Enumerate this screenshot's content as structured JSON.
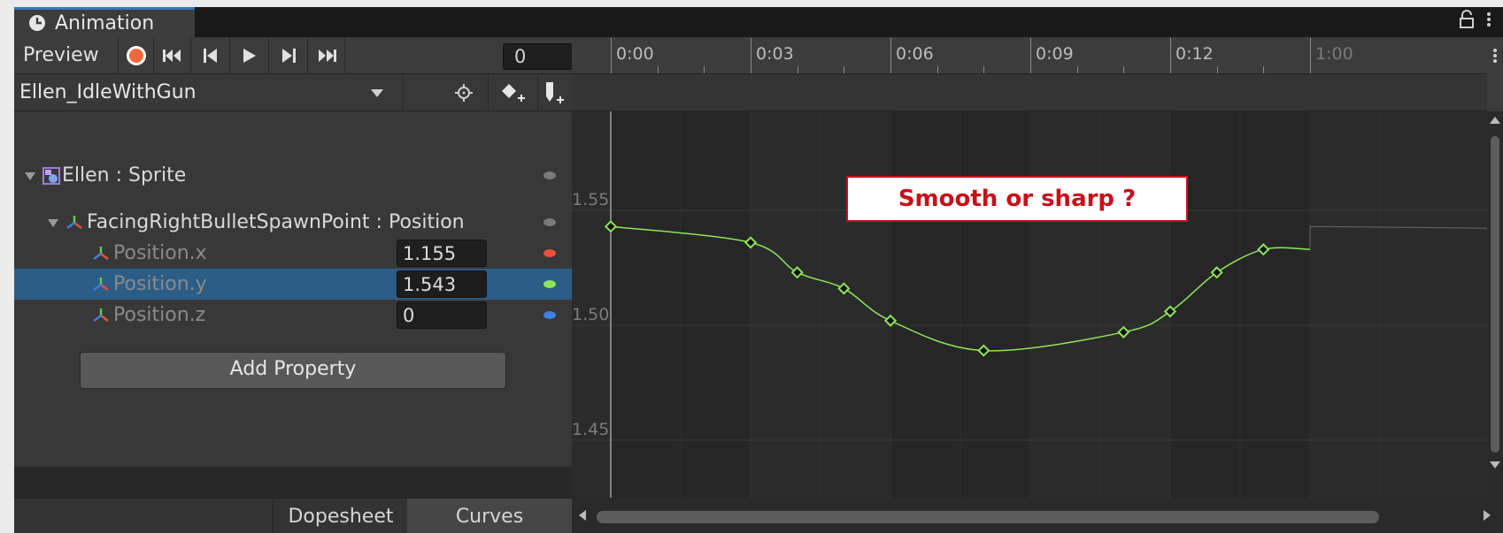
{
  "window": {
    "tab_title": "Animation"
  },
  "toolbar": {
    "preview_label": "Preview",
    "frame_value": "0"
  },
  "clip": {
    "name": "Ellen_IdleWithGun"
  },
  "hierarchy": {
    "rows": [
      {
        "label": "Ellen : Sprite"
      },
      {
        "label": "FacingRightBulletSpawnPoint : Position"
      },
      {
        "label": "Position.x",
        "value": "1.155",
        "curve_color": "#e8503a"
      },
      {
        "label": "Position.y",
        "value": "1.543",
        "curve_color": "#8ee65a"
      },
      {
        "label": "Position.z",
        "value": "0",
        "curve_color": "#3f7fe0"
      }
    ],
    "add_property_label": "Add Property"
  },
  "bottom_tabs": {
    "dopesheet": "Dopesheet",
    "curves": "Curves"
  },
  "timeline": {
    "labels": [
      "0:00",
      "0:03",
      "0:06",
      "0:09",
      "0:12",
      "1:00"
    ],
    "y_labels": [
      "1.55",
      "1.50",
      "1.45"
    ]
  },
  "annotation": {
    "text": "Smooth or sharp  ?"
  },
  "chart_data": {
    "type": "line",
    "xlabel": "",
    "ylabel": "",
    "series": [
      {
        "color": "#8ee65a",
        "x": [
          0,
          3,
          4,
          5,
          6,
          8,
          11,
          12,
          13,
          14,
          15
        ],
        "values": [
          1.543,
          1.536,
          1.523,
          1.516,
          1.502,
          1.489,
          1.497,
          1.506,
          1.523,
          1.533,
          1.533
        ]
      }
    ],
    "ylim": [
      1.45,
      1.55
    ]
  }
}
